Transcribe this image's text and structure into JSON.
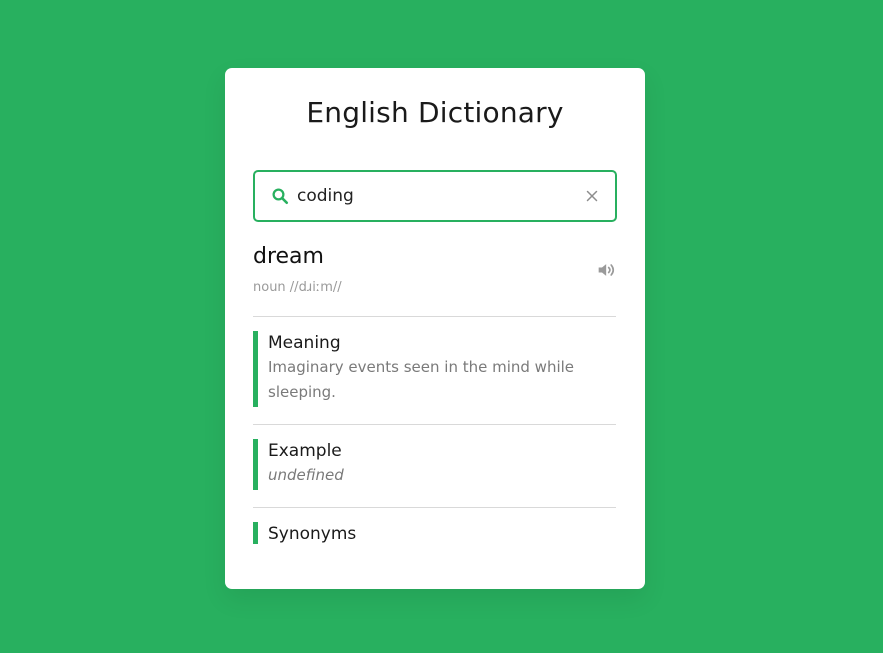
{
  "app": {
    "title": "English Dictionary"
  },
  "search": {
    "value": "coding",
    "placeholder": ""
  },
  "result": {
    "word": "dream",
    "phonetic": "noun //dɹiːm//"
  },
  "sections": [
    {
      "title": "Meaning",
      "text": "Imaginary events seen in the mind while sleeping."
    },
    {
      "title": "Example",
      "text": "undefined"
    },
    {
      "title": "Synonyms",
      "text": ""
    }
  ],
  "icons": {
    "search": "search-icon",
    "clear": "close-icon",
    "volume": "volume-icon"
  },
  "colors": {
    "background": "#28b05f",
    "accent": "#28b05f",
    "card": "#ffffff",
    "muted_text": "#7a7a7a"
  }
}
